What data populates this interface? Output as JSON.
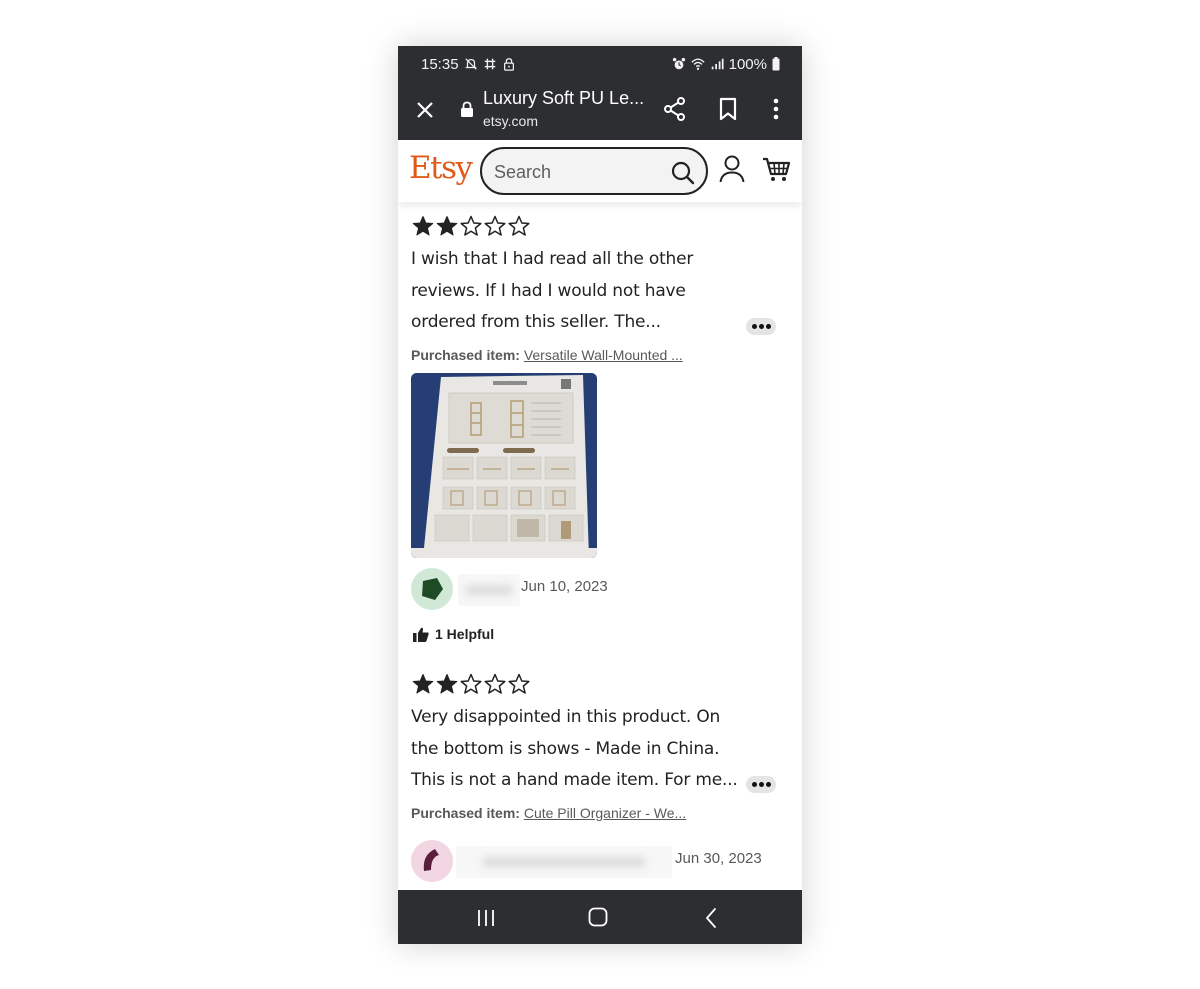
{
  "status_bar": {
    "time": "15:35",
    "left_icons": [
      "notifications-muted-icon",
      "slack-icon",
      "lock-icon"
    ],
    "right_icons": [
      "alarm-icon",
      "wifi-icon",
      "signal-icon"
    ],
    "battery": "100%"
  },
  "browser": {
    "page_title": "Luxury Soft PU Le...",
    "url": "etsy.com",
    "icons": [
      "close-icon",
      "lock-icon",
      "share-icon",
      "bookmark-icon",
      "more-vertical-icon"
    ]
  },
  "header": {
    "logo": "Etsy",
    "search_placeholder": "Search",
    "search_value": "",
    "brand_color": "#e05b1a"
  },
  "reviews": [
    {
      "rating": 2,
      "max_rating": 5,
      "text": "I wish that I had read all the other reviews. If I had I would not have ordered from this seller. The...",
      "purchased_label": "Purchased item:",
      "purchased_item": "Versatile Wall-Mounted ...",
      "has_photo": true,
      "photo_description": "Assembly instruction sheet for a wall-mounted shelf",
      "avatar_color": "#1e4a26",
      "avatar_bg": "#d2e8d6",
      "date": "Jun 10, 2023",
      "helpful_count": "1 Helpful"
    },
    {
      "rating": 2,
      "max_rating": 5,
      "text": "Very disappointed in this product. On the bottom is shows - Made in China. This is not a hand made item. For me...",
      "purchased_label": "Purchased item:",
      "purchased_item": "Cute Pill Organizer - We...",
      "has_photo": false,
      "avatar_color": "#5a1e3e",
      "avatar_bg": "#f2d6e2",
      "date": "Jun 30, 2023"
    }
  ],
  "nav_bar": {
    "buttons": [
      "recent-apps",
      "home",
      "back"
    ]
  }
}
